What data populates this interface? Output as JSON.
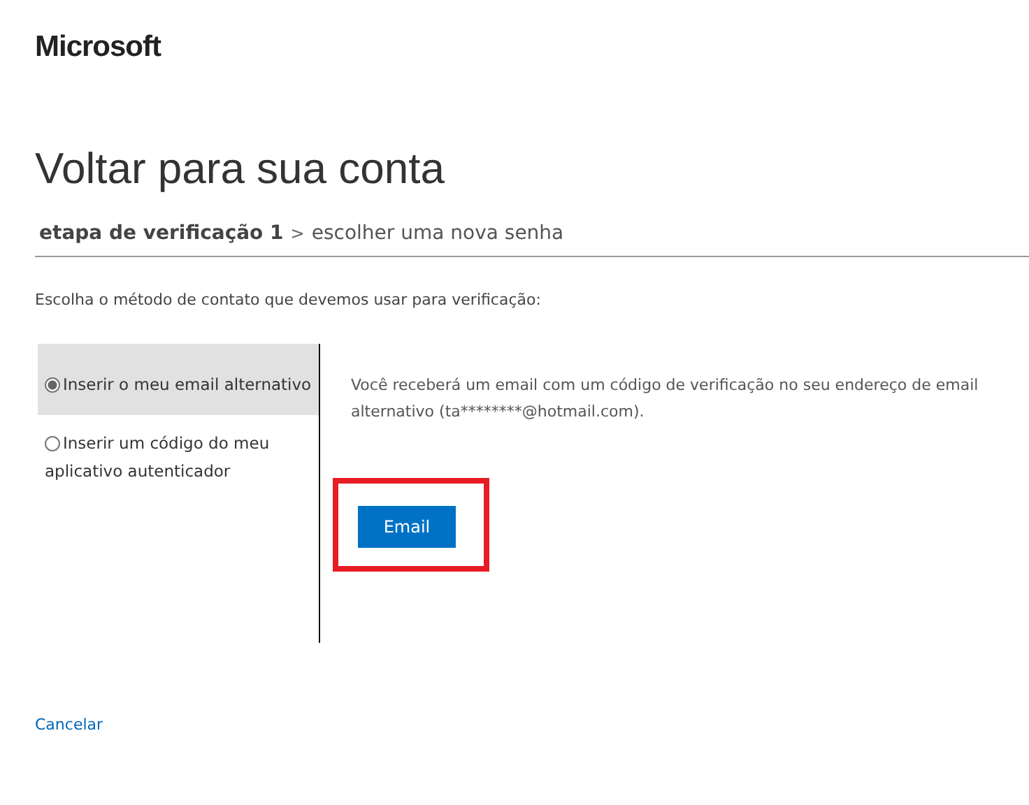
{
  "logo": "Microsoft",
  "title": "Voltar para sua conta",
  "steps": [
    {
      "label": "etapa de verificação 1",
      "selected": true
    },
    {
      "label": "escolher uma nova senha",
      "selected": false
    }
  ],
  "separator": ">",
  "instruction": "Escolha o método de contato que devemos usar para verificação:",
  "options": [
    {
      "label": "Inserir o meu email alternativo",
      "selected": true
    },
    {
      "label": "Inserir um código do meu aplicativo autenticador",
      "selected": false
    }
  ],
  "description": "Você receberá um email com um código de verificação no seu endereço de email alternativo (ta********@hotmail.com).",
  "button": {
    "label": "Email",
    "highlighted": true
  },
  "cancel": "Cancelar"
}
